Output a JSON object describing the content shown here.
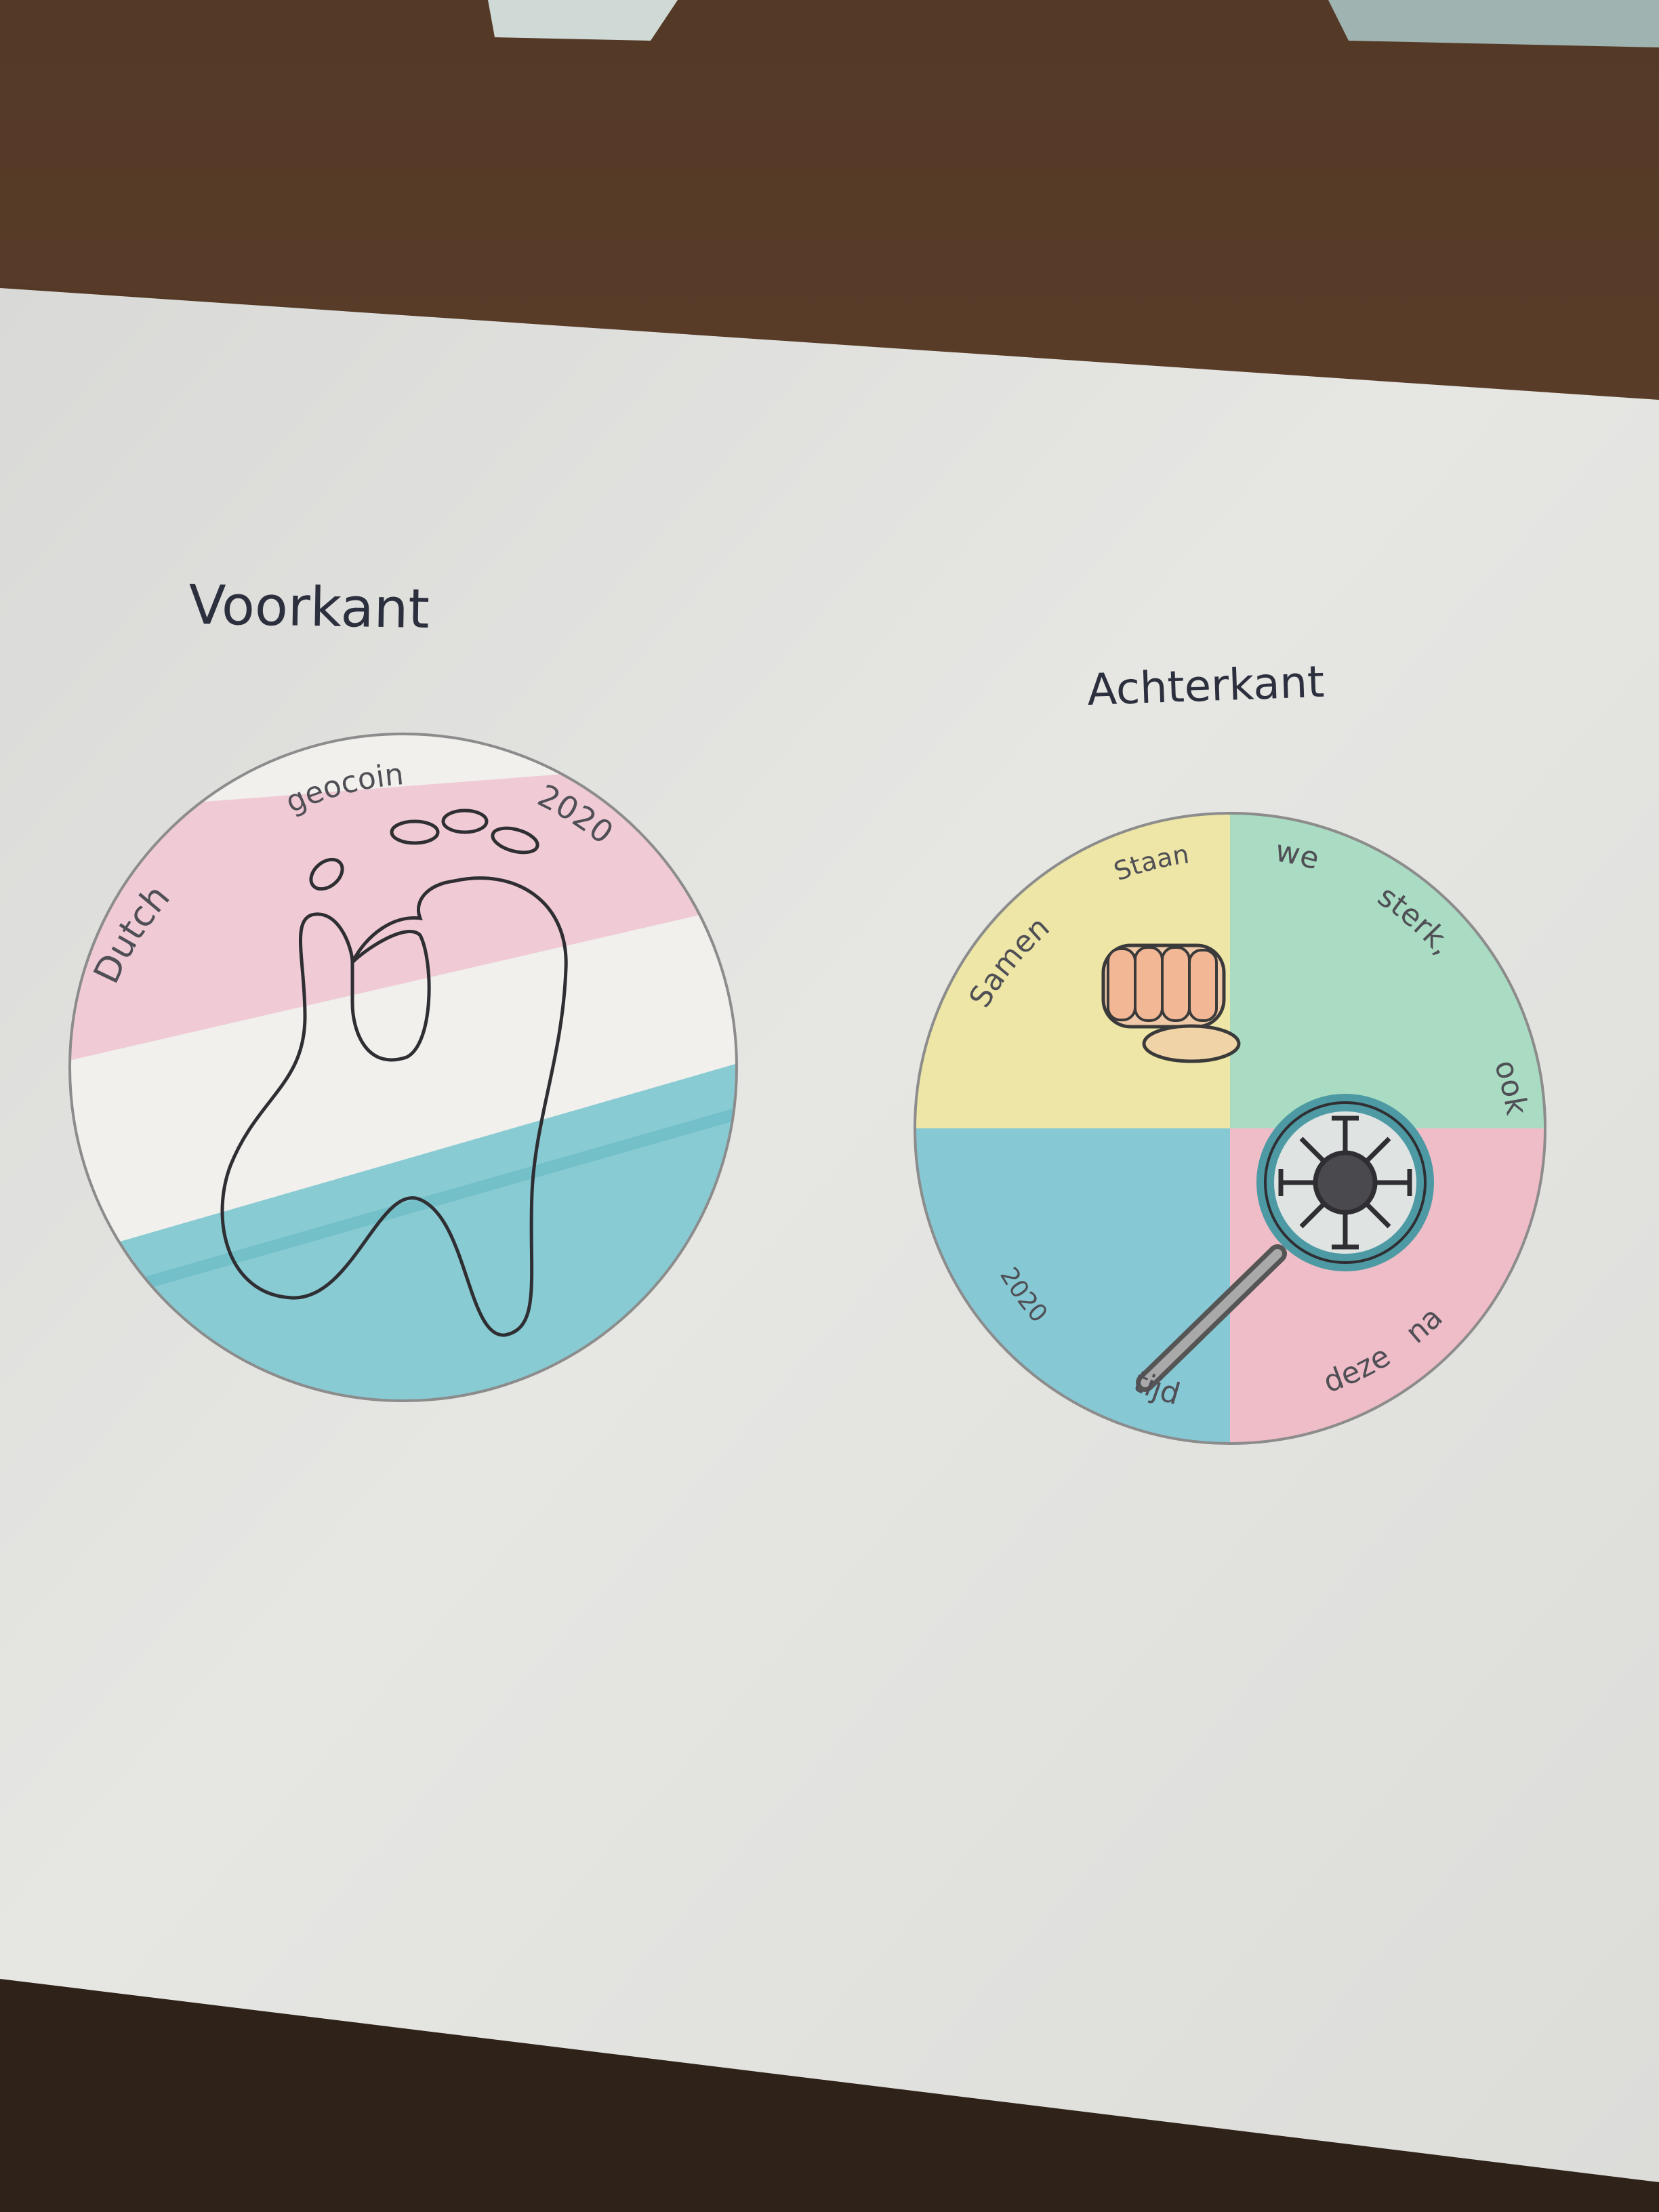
{
  "labels": {
    "front": "Voorkant",
    "back": "Achterkant"
  },
  "front_coin": {
    "word_left": "Dutch",
    "word_top": "geocoin",
    "year": "2020",
    "flag_colors": [
      "#efc7d1",
      "#f3f1ee",
      "#7cc6cf"
    ],
    "picture": "footprint-drawing"
  },
  "back_coin": {
    "word_samen": "Samen",
    "word_staan": "Staan",
    "word_we": "we",
    "word_sterk": "sterk,",
    "word_ook": "ook",
    "word_na": "na",
    "word_deze": "deze",
    "word_tijd": "tijd",
    "year": "2020",
    "quadrant_colors": [
      "#eee6a6",
      "#a9dcc2",
      "#86c8d4",
      "#efbdc7"
    ],
    "pictures": [
      "fist-drawing",
      "magnifier-drawing",
      "virus-drawing"
    ]
  }
}
